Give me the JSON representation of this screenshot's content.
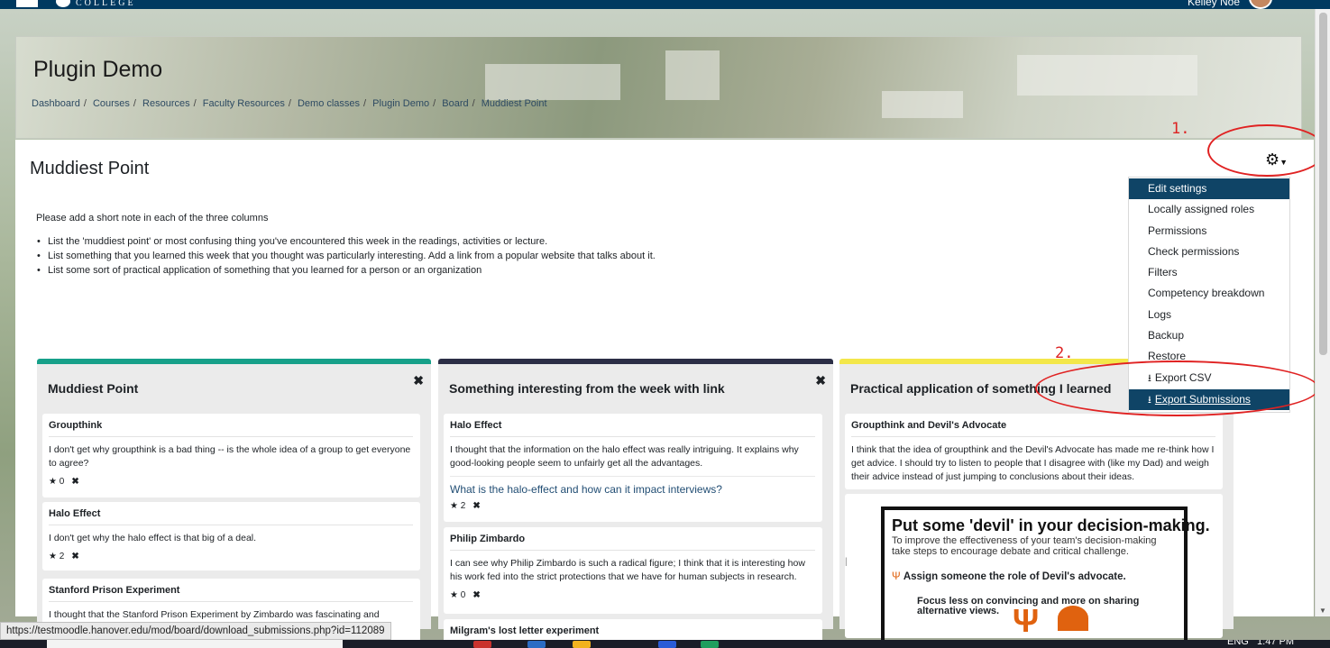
{
  "navbar": {
    "site_name": "COLLEGE",
    "user_name": "Kelley Noe"
  },
  "page_header": {
    "title": "Plugin Demo",
    "breadcrumb": [
      "Dashboard",
      "Courses",
      "Resources",
      "Faculty Resources",
      "Demo classes",
      "Plugin Demo",
      "Board",
      "Muddiest Point"
    ]
  },
  "activity": {
    "title": "Muddiest Point",
    "intro": "Please add a short note in each of the three columns",
    "bullets": [
      "List the 'muddiest point' or most confusing thing you've encountered this week in the readings, activities or lecture.",
      "List something that you learned this week that you thought was particularly interesting. Add a link from a popular website that talks about it.",
      "List some sort of practical application of something that you learned for a person or an organization"
    ]
  },
  "settings_menu": {
    "items": [
      "Edit settings",
      "Locally assigned roles",
      "Permissions",
      "Check permissions",
      "Filters",
      "Competency breakdown",
      "Logs",
      "Backup",
      "Restore",
      "Export CSV",
      "Export Submissions"
    ]
  },
  "columns": [
    {
      "heading": "Muddiest Point",
      "color": "#16a089",
      "notes": [
        {
          "title": "Groupthink",
          "body": "I don't get why groupthink is a bad thing -- is the whole idea of a group to get everyone to agree?",
          "rating": "0"
        },
        {
          "title": "Halo Effect",
          "body": "I don't get why the halo effect is that big of a deal.",
          "rating": "2"
        },
        {
          "title": "Stanford Prison Experiment",
          "body": "I thought that the Stanford Prison Experiment by Zimbardo was fascinating and chilling. It"
        }
      ]
    },
    {
      "heading": "Something interesting from the week with link",
      "color": "#2b2e46",
      "notes": [
        {
          "title": "Halo Effect",
          "body": "I thought that the information on the halo effect was really intriguing. It explains why good-looking people seem to unfairly get all the advantages.",
          "link": "What is the halo-effect and how can it impact interviews?",
          "rating": "2"
        },
        {
          "title": "Philip Zimbardo",
          "body": "I can see why Philip Zimbardo is such a radical figure; I think that it is interesting how his work fed into the strict protections that we have for human subjects in research.",
          "rating": "0"
        },
        {
          "title": "Milgram's lost letter experiment"
        }
      ]
    },
    {
      "heading": "Practical application of something I learned",
      "color": "#f3e74a",
      "notes": [
        {
          "title": "Groupthink and Devil's Advocate",
          "body": "I think that the idea of groupthink and the Devil's Advocate has made me re-think how I get advice. I should try to listen to people that I disagree with (like my Dad) and weigh their advice instead of just jumping to conclusions about their ideas."
        }
      ],
      "poster": {
        "title": "Put some 'devil' in your decision-making.",
        "subtitle": "To improve the effectiveness of your team's decision-making take steps to encourage debate and critical challenge.",
        "step1": "Assign someone the role of Devil's advocate.",
        "step2": "Focus less on convincing and more on sharing alternative views."
      }
    }
  ],
  "annotations": {
    "step1": "1.",
    "step2": "2.",
    "color": "#e02222"
  },
  "status_bar": {
    "url": "https://testmoodle.hanover.edu/mod/board/download_submissions.php?id=112089"
  },
  "taskbar": {
    "language": "ENG",
    "time": "1:47 PM"
  }
}
